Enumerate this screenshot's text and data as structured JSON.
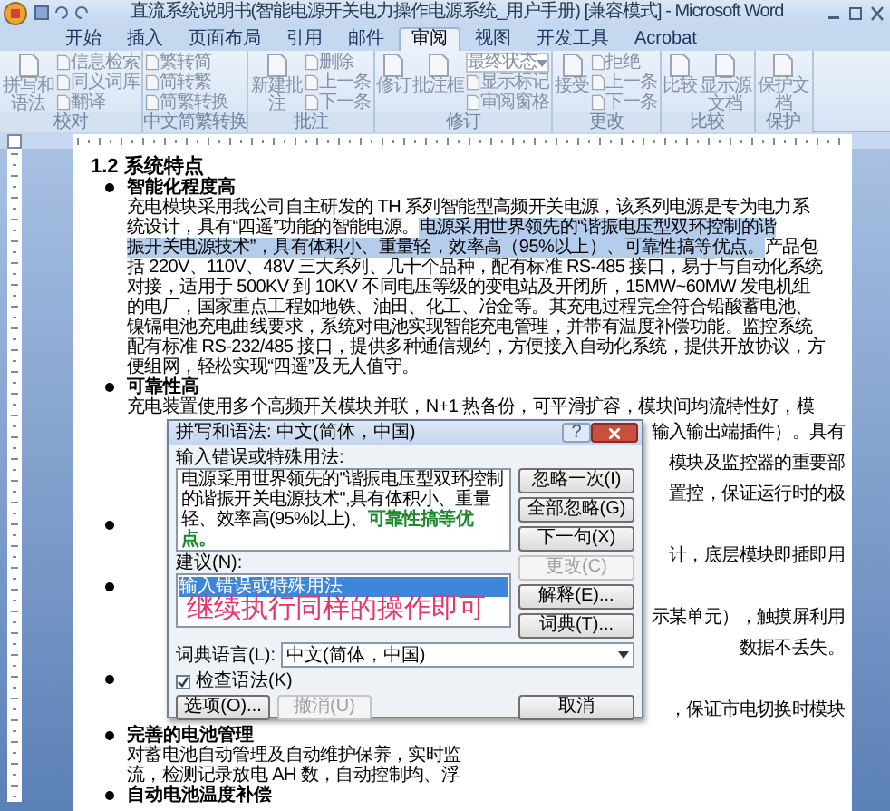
{
  "window": {
    "title": "直流系统说明书(智能电源开关电力操作电源系统_用户手册) [兼容模式] - Microsoft Word"
  },
  "tabs": [
    {
      "label": "开始",
      "selected": false
    },
    {
      "label": "插入",
      "selected": false
    },
    {
      "label": "页面布局",
      "selected": false
    },
    {
      "label": "引用",
      "selected": false
    },
    {
      "label": "邮件",
      "selected": false
    },
    {
      "label": "审阅",
      "selected": true
    },
    {
      "label": "视图",
      "selected": false
    },
    {
      "label": "开发工具",
      "selected": false
    },
    {
      "label": "Acrobat",
      "selected": false
    }
  ],
  "ribbon_groups": [
    {
      "label": "校对",
      "items": [
        {
          "kind": "large",
          "label": "拼写和语法"
        },
        {
          "kind": "small",
          "label": "信息检索"
        },
        {
          "kind": "small",
          "label": "同义词库"
        },
        {
          "kind": "small",
          "label": "翻译"
        }
      ]
    },
    {
      "label": "中文简繁转换",
      "items": [
        {
          "kind": "small",
          "label": "繁转简"
        },
        {
          "kind": "small",
          "label": "简转繁"
        },
        {
          "kind": "small",
          "label": "简繁转换"
        }
      ]
    },
    {
      "label": "批注",
      "items": [
        {
          "kind": "large",
          "label": "新建批注"
        },
        {
          "kind": "small",
          "label": "删除"
        },
        {
          "kind": "small",
          "label": "上一条"
        },
        {
          "kind": "small",
          "label": "下一条"
        }
      ]
    },
    {
      "label": "修订",
      "items": [
        {
          "kind": "large",
          "label": "修订"
        },
        {
          "kind": "large",
          "label": "批注框"
        },
        {
          "kind": "dropdown",
          "label": "最终状态"
        },
        {
          "kind": "small",
          "label": "显示标记"
        },
        {
          "kind": "small",
          "label": "审阅窗格"
        }
      ]
    },
    {
      "label": "更改",
      "items": [
        {
          "kind": "large",
          "label": "接受"
        },
        {
          "kind": "small",
          "label": "拒绝"
        },
        {
          "kind": "small",
          "label": "上一条"
        },
        {
          "kind": "small",
          "label": "下一条"
        }
      ]
    },
    {
      "label": "比较",
      "items": [
        {
          "kind": "large",
          "label": "比较"
        },
        {
          "kind": "large",
          "label": "显示源文档"
        }
      ]
    },
    {
      "label": "保护",
      "items": [
        {
          "kind": "large",
          "label": "保护文档"
        }
      ]
    }
  ],
  "document": {
    "lines": [
      {
        "kind": "heading",
        "text": "1.2 系统特点"
      },
      {
        "kind": "bullet",
        "text": "智能化程度高"
      },
      {
        "kind": "body",
        "segments": [
          {
            "text": "充电模块采用我公司自主研发的 TH 系列智能型高频开关电源，该系列电源是专为电力系",
            "highlighted": false
          }
        ]
      },
      {
        "kind": "body",
        "segments": [
          {
            "text": "统设计，具有“四遥”功能的智能电源。",
            "highlighted": false
          },
          {
            "text": "电源采用世界领先的“谐振电压型双环控制的谐",
            "highlighted": true
          }
        ]
      },
      {
        "kind": "body",
        "segments": [
          {
            "text": "振开关电源技术”，具有体积小、重量轻，效率高（95%以上）、可靠性搞等优点。",
            "highlighted": true
          },
          {
            "text": "产品包",
            "highlighted": false
          }
        ]
      },
      {
        "kind": "body",
        "segments": [
          {
            "text": "括 220V、110V、48V 三大系列、几十个品种，配有标准 RS-485 接口，易于与自动化系统",
            "highlighted": false
          }
        ]
      },
      {
        "kind": "body",
        "segments": [
          {
            "text": "对接，适用于 500KV 到 10KV 不同电压等级的变电站及开闭所，15MW~60MW 发电机组",
            "highlighted": false
          }
        ]
      },
      {
        "kind": "body",
        "segments": [
          {
            "text": "的电厂，国家重点工程如地铁、油田、化工、冶金等。其充电过程完全符合铅酸蓄电池、",
            "highlighted": false
          }
        ]
      },
      {
        "kind": "body",
        "segments": [
          {
            "text": "镍镉电池充电曲线要求，系统对电池实现智能充电管理，并带有温度补偿功能。监控系统",
            "highlighted": false
          }
        ]
      },
      {
        "kind": "body",
        "segments": [
          {
            "text": "配有标准 RS-232/485 接口，提供多种通信规约，方便接入自动化系统，提供开放协议，方",
            "highlighted": false
          }
        ]
      },
      {
        "kind": "body",
        "segments": [
          {
            "text": "便组网，轻松实现“四遥”及无人值守。",
            "highlighted": false
          }
        ]
      },
      {
        "kind": "bullet",
        "text": "可靠性高"
      },
      {
        "kind": "body",
        "segments": [
          {
            "text": "充电装置使用多个高频开关模块并联，N+1 热备份，可平滑扩容，模块间均流特性好，模",
            "highlighted": false
          }
        ]
      },
      {
        "kind": "tail",
        "text": "输入输出端插件）。具有"
      },
      {
        "kind": "tail",
        "text": "模块及监控器的重要部"
      },
      {
        "kind": "tail",
        "text": "置控，保证运行时的极"
      },
      {
        "kind": "covered_bullet"
      },
      {
        "kind": "tail",
        "text": "计，底层模块即插即用"
      },
      {
        "kind": "covered_bullet"
      },
      {
        "kind": "tail",
        "text": "示某单元），触摸屏利用"
      },
      {
        "kind": "tail",
        "text": "数据不丢失。"
      },
      {
        "kind": "covered_bullet"
      },
      {
        "kind": "tail",
        "text": "，保证市电切换时模块"
      },
      {
        "kind": "bullet",
        "text": "完善的电池管理"
      },
      {
        "kind": "body",
        "segments": [
          {
            "text": "对蓄电池自动管理及自动维护保养，实时监",
            "highlighted": false
          }
        ]
      },
      {
        "kind": "body",
        "segments": [
          {
            "text": "流，检测记录放电 AH 数，自动控制均、浮",
            "highlighted": false
          }
        ]
      },
      {
        "kind": "bullet",
        "text": "自动电池温度补偿"
      }
    ]
  },
  "dialog": {
    "title": "拼写和语法: 中文(简体，中国)",
    "help": "?",
    "error_label": "输入错误或特殊用法:",
    "sentence": [
      {
        "text": "电源采用世界领先的\"谐振电压型双环控制的谐振开关电源技术\",具有体积小、重量轻、效率高(95%以上)、",
        "flagged": false
      },
      {
        "text": "可靠性搞等优点。",
        "flagged": true
      }
    ],
    "suggestions_label": "建议(N):",
    "suggestions": [
      {
        "text": "输入错误或特殊用法",
        "selected": true
      }
    ],
    "top_buttons": [
      {
        "label": "忽略一次(I)",
        "disabled": false
      },
      {
        "label": "全部忽略(G)",
        "disabled": false
      },
      {
        "label": "下一句(X)",
        "disabled": false
      }
    ],
    "side_buttons": [
      {
        "label": "更改(C)",
        "disabled": true
      },
      {
        "label": "解释(E)...",
        "disabled": false
      },
      {
        "label": "词典(T)...",
        "disabled": false
      }
    ],
    "language_label": "词典语言(L):",
    "language": "中文(简体，中国)",
    "check_grammar": {
      "label": "检查语法(K)",
      "checked": true
    },
    "bottom_buttons": [
      {
        "label": "选项(O)...",
        "disabled": false
      },
      {
        "label": "撤消(U)",
        "disabled": true
      }
    ],
    "cancel": {
      "label": "取消",
      "disabled": false
    }
  },
  "annotation": {
    "text": "继续执行同样的操作即可"
  }
}
